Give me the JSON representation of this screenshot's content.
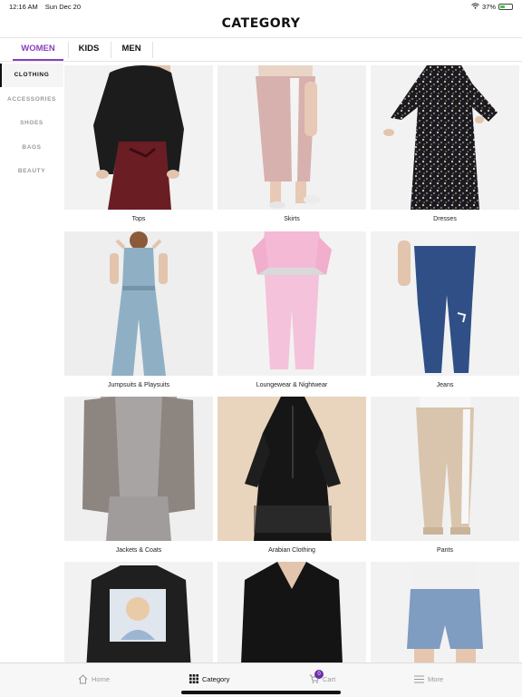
{
  "status_bar": {
    "time": "12:16 AM",
    "date": "Sun Dec 20",
    "battery": "37%"
  },
  "header": {
    "title": "CATEGORY"
  },
  "gender_tabs": [
    {
      "label": "WOMEN",
      "active": true
    },
    {
      "label": "KIDS",
      "active": false
    },
    {
      "label": "MEN",
      "active": false
    }
  ],
  "sidebar": {
    "items": [
      {
        "label": "CLOTHING",
        "active": true
      },
      {
        "label": "ACCESSORIES",
        "active": false
      },
      {
        "label": "SHOES",
        "active": false
      },
      {
        "label": "BAGS",
        "active": false
      },
      {
        "label": "BEAUTY",
        "active": false
      }
    ]
  },
  "categories": [
    {
      "label": "Tops",
      "icon": "top-photo"
    },
    {
      "label": "Skirts",
      "icon": "skirt-photo"
    },
    {
      "label": "Dresses",
      "icon": "dress-photo"
    },
    {
      "label": "Jumpsuits & Playsuits",
      "icon": "jumpsuit-photo"
    },
    {
      "label": "Loungewear & Nightwear",
      "icon": "loungewear-photo"
    },
    {
      "label": "Jeans",
      "icon": "jeans-photo"
    },
    {
      "label": "Jackets & Coats",
      "icon": "jacket-photo"
    },
    {
      "label": "Arabian Clothing",
      "icon": "abaya-photo"
    },
    {
      "label": "Pants",
      "icon": "pants-photo"
    },
    {
      "label": "",
      "icon": "graphic-sweatshirt-photo"
    },
    {
      "label": "",
      "icon": "vneck-top-photo"
    },
    {
      "label": "",
      "icon": "denim-shorts-photo"
    }
  ],
  "tab_bar": {
    "home": "Home",
    "category": "Category",
    "cart": "Cart",
    "cart_count": "0",
    "more": "More"
  },
  "colors": {
    "accent": "#8a3fbf",
    "badge": "#6d2fa8"
  }
}
